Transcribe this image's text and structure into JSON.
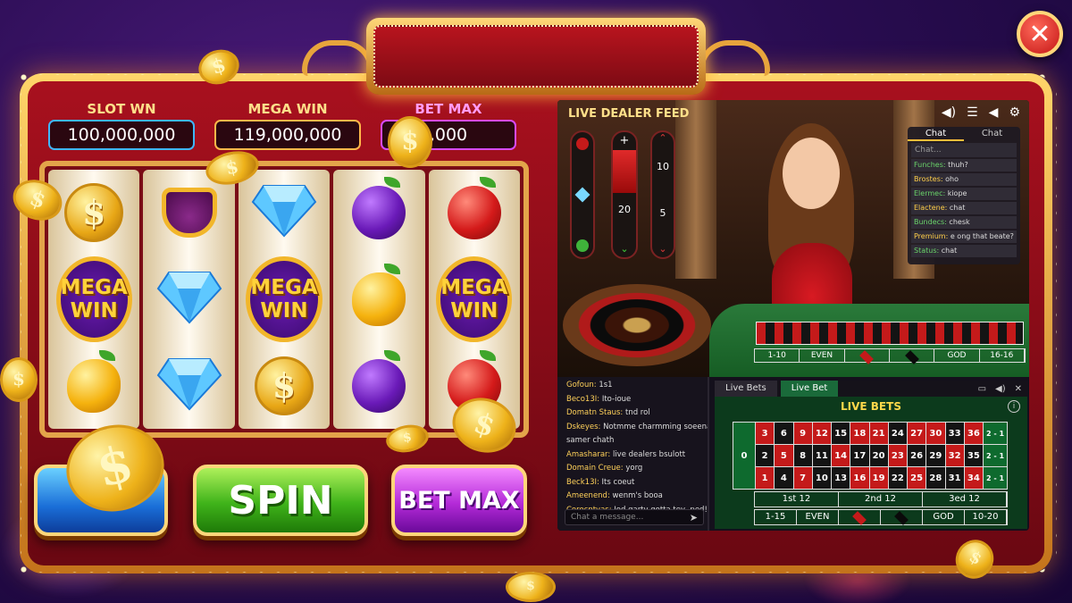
{
  "slot": {
    "counters": [
      {
        "label": "SLOT WN",
        "value": "100,000,000"
      },
      {
        "label": "MEGA WIN",
        "value": "119,000,000"
      },
      {
        "label": "BET MAX",
        "value": ",000"
      }
    ],
    "mega_symbol": [
      "MEGA",
      "WIN"
    ],
    "dollar_glyph": "$",
    "reels": [
      [
        "dollar-coin",
        "mega-win",
        "lemon"
      ],
      [
        "crown-fruit",
        "diamond",
        "diamond"
      ],
      [
        "diamond",
        "mega-win",
        "dollar-coin"
      ],
      [
        "plum",
        "lemon",
        "plum"
      ],
      [
        "apple",
        "mega-win",
        "apple"
      ]
    ],
    "spin_label": "SPIN",
    "bet_max_label": "BET MAX"
  },
  "live": {
    "feed_title": "LIVE DEALER FEED",
    "bar_values": [
      "20",
      "10",
      "5"
    ],
    "chat_tabs": [
      "Chat",
      "Chat"
    ],
    "chat_placeholder": "Chat...",
    "chat_lines": [
      {
        "user": "Funches:",
        "text": " thuh?"
      },
      {
        "user": "Brostes:",
        "text": " oho"
      },
      {
        "user": "Elermec:",
        "text": " kiope"
      },
      {
        "user": "Elactene:",
        "text": " chat"
      },
      {
        "user": "Bundecs:",
        "text": " chesk"
      },
      {
        "user": "Premium:",
        "text": " e ong that beate?"
      },
      {
        "user": "Status:",
        "text": " chat"
      }
    ],
    "table_row": [
      "1-10",
      "EVEN",
      "",
      "",
      "GOD",
      "16-16"
    ],
    "lower_chat": [
      {
        "user": "Gofoun:",
        "text": " 1s1"
      },
      {
        "user": "Beco13I:",
        "text": " Ito-ioue"
      },
      {
        "user": "Domatn Staus:",
        "text": " tnd rol"
      },
      {
        "user": "Dskeyes:",
        "text": " Notmme charmming soeena"
      },
      {
        "user": "",
        "text": "samer chath"
      },
      {
        "user": "Amasharar:",
        "text": " live dealers bsulott"
      },
      {
        "user": "Domain Creue:",
        "text": " yorg"
      },
      {
        "user": "Beck13I:",
        "text": " Its coeut"
      },
      {
        "user": "Ameenend:",
        "text": " wenm's booa"
      },
      {
        "user": "Corocntyas:",
        "text": " Iod garty gotta tey, ped!"
      }
    ],
    "lower_chat_placeholder": "Chat a message...",
    "bets_tabs": [
      "Live Bets",
      "Live Bet"
    ],
    "bets_title": "LIVE BETS",
    "roulette_rows": [
      [
        "3",
        "6",
        "9",
        "12",
        "15",
        "18",
        "21",
        "24",
        "27",
        "30",
        "33",
        "36"
      ],
      [
        "2",
        "5",
        "8",
        "11",
        "14",
        "17",
        "20",
        "23",
        "26",
        "29",
        "32",
        "35"
      ],
      [
        "1",
        "4",
        "7",
        "10",
        "13",
        "16",
        "19",
        "22",
        "25",
        "28",
        "31",
        "34"
      ]
    ],
    "roulette_colors": [
      [
        "r",
        "k",
        "r",
        "r",
        "k",
        "r",
        "r",
        "k",
        "r",
        "r",
        "k",
        "r"
      ],
      [
        "k",
        "r",
        "k",
        "k",
        "r",
        "k",
        "k",
        "r",
        "k",
        "k",
        "r",
        "k"
      ],
      [
        "r",
        "k",
        "r",
        "k",
        "k",
        "r",
        "r",
        "k",
        "r",
        "k",
        "k",
        "r"
      ]
    ],
    "zero": "0",
    "column_bet": "2 - 1",
    "dozens": [
      "1st 12",
      "2nd 12",
      "3ed 12"
    ],
    "outside": [
      "1-15",
      "EVEN",
      "",
      "",
      "GOD",
      "10-20"
    ]
  },
  "close_glyph": "✕",
  "colors": {
    "frame_gold": "#e8a43c",
    "frame_red": "#a8101e",
    "spin_green": "#3fb31a",
    "betmax_purple": "#b42ad8"
  }
}
